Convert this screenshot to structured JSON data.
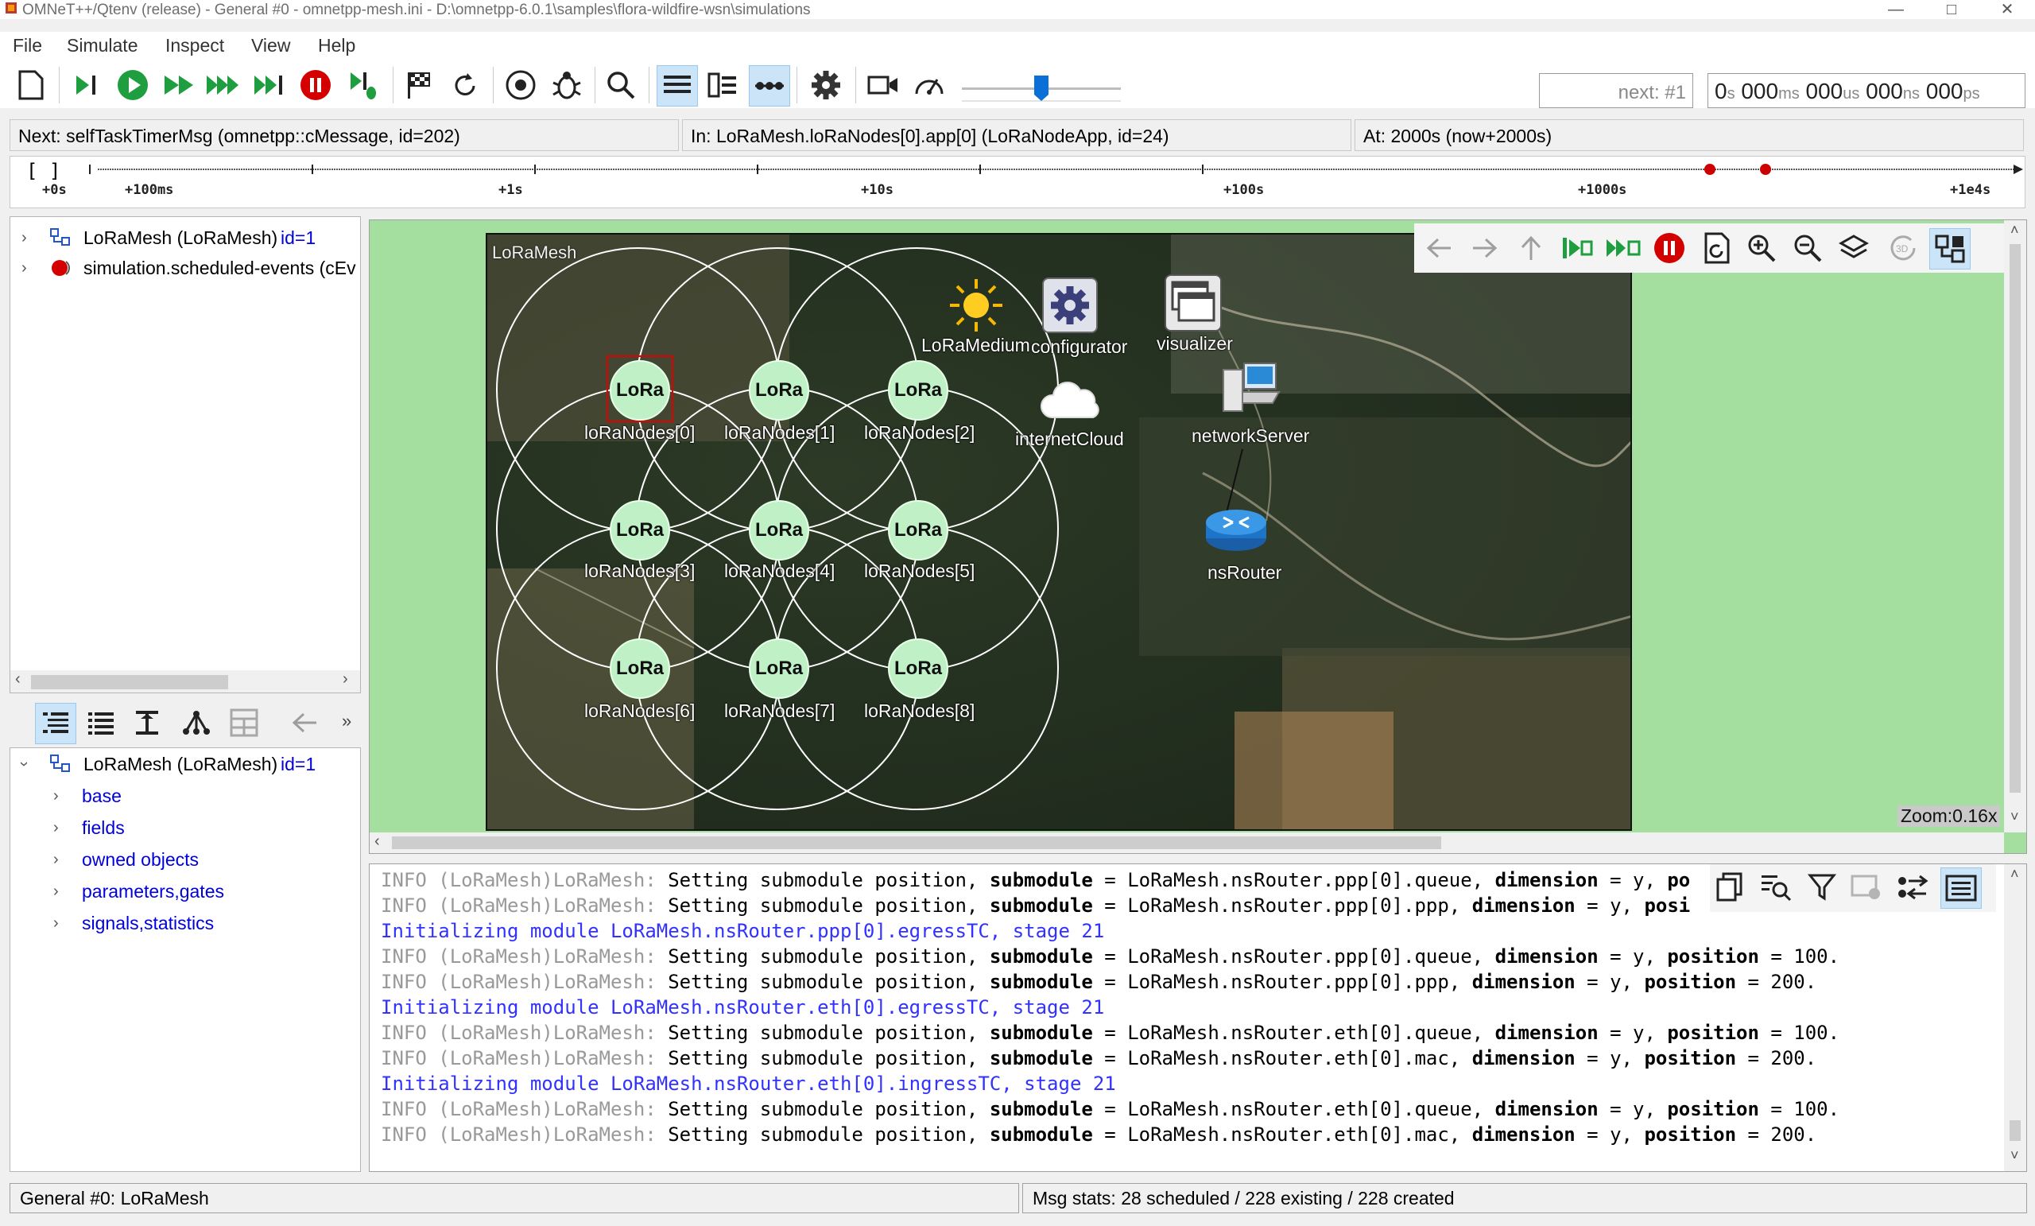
{
  "window": {
    "title": "OMNeT++/Qtenv (release) - General #0 - omnetpp-mesh.ini - D:\\omnetpp-6.0.1\\samples\\flora-wildfire-wsn\\simulations"
  },
  "menu": [
    "File",
    "Simulate",
    "Inspect",
    "View",
    "Help"
  ],
  "toolbar": {
    "next_event": "next: #1",
    "time_display": {
      "s_val": "0",
      "s_unit": "s",
      "ms_val": "000",
      "ms_unit": "ms",
      "us_val": "000",
      "us_unit": "us",
      "ns_val": "000",
      "ns_unit": "ns",
      "ps_val": "000",
      "ps_unit": "ps"
    }
  },
  "status": {
    "next": "Next: selfTaskTimerMsg (omnetpp::cMessage, id=202)",
    "in": "In: LoRaMesh.loRaNodes[0].app[0] (LoRaNodeApp, id=24)",
    "at": "At: 2000s (now+2000s)"
  },
  "timeline": {
    "bracket": "[ ]",
    "labels": [
      "+0s",
      "+100ms",
      "+1s",
      "+10s",
      "+100s",
      "+1000s",
      "+1e4s"
    ]
  },
  "object_tree": {
    "root": {
      "name": "LoRaMesh (LoRaMesh)",
      "id": "id=1"
    },
    "events": "simulation.scheduled-events (cEv"
  },
  "inspector_tree": {
    "root": {
      "name": "LoRaMesh (LoRaMesh)",
      "id": "id=1"
    },
    "children": [
      "base",
      "fields",
      "owned objects",
      "parameters,gates",
      "signals,statistics"
    ]
  },
  "network": {
    "name": "LoRaMesh",
    "zoom": "Zoom:0.16x",
    "nodes": [
      "loRaNodes[0]",
      "loRaNodes[1]",
      "loRaNodes[2]",
      "loRaNodes[3]",
      "loRaNodes[4]",
      "loRaNodes[5]",
      "loRaNodes[6]",
      "loRaNodes[7]",
      "loRaNodes[8]"
    ],
    "node_icon_text": "LoRa",
    "modules": {
      "medium": "LoRaMedium",
      "configurator": "configurator",
      "visualizer": "visualizer",
      "cloud": "internetCloud",
      "server": "networkServer",
      "router": "nsRouter"
    }
  },
  "log": [
    {
      "kind": "info",
      "prefix": "INFO (LoRaMesh)LoRaMesh:",
      "text1": " Setting submodule position, ",
      "k1": "submodule",
      "text2": " = LoRaMesh.nsRouter.ppp[0].queue, ",
      "k2": "dimension",
      "text3": " = y, ",
      "k3": "po",
      "text4": ""
    },
    {
      "kind": "info",
      "prefix": "INFO (LoRaMesh)LoRaMesh:",
      "text1": " Setting submodule position, ",
      "k1": "submodule",
      "text2": " = LoRaMesh.nsRouter.ppp[0].ppp, ",
      "k2": "dimension",
      "text3": " = y, ",
      "k3": "posi",
      "text4": ""
    },
    {
      "kind": "init",
      "text": "Initializing module LoRaMesh.nsRouter.ppp[0].egressTC, stage 21"
    },
    {
      "kind": "info",
      "prefix": "INFO (LoRaMesh)LoRaMesh:",
      "text1": " Setting submodule position, ",
      "k1": "submodule",
      "text2": " = LoRaMesh.nsRouter.ppp[0].queue, ",
      "k2": "dimension",
      "text3": " = y, ",
      "k3": "position",
      "text4": " = 100."
    },
    {
      "kind": "info",
      "prefix": "INFO (LoRaMesh)LoRaMesh:",
      "text1": " Setting submodule position, ",
      "k1": "submodule",
      "text2": " = LoRaMesh.nsRouter.ppp[0].ppp, ",
      "k2": "dimension",
      "text3": " = y, ",
      "k3": "position",
      "text4": " = 200."
    },
    {
      "kind": "init",
      "text": "Initializing module LoRaMesh.nsRouter.eth[0].egressTC, stage 21"
    },
    {
      "kind": "info",
      "prefix": "INFO (LoRaMesh)LoRaMesh:",
      "text1": " Setting submodule position, ",
      "k1": "submodule",
      "text2": " = LoRaMesh.nsRouter.eth[0].queue, ",
      "k2": "dimension",
      "text3": " = y, ",
      "k3": "position",
      "text4": " = 100."
    },
    {
      "kind": "info",
      "prefix": "INFO (LoRaMesh)LoRaMesh:",
      "text1": " Setting submodule position, ",
      "k1": "submodule",
      "text2": " = LoRaMesh.nsRouter.eth[0].mac, ",
      "k2": "dimension",
      "text3": " = y, ",
      "k3": "position",
      "text4": " = 200."
    },
    {
      "kind": "init",
      "text": "Initializing module LoRaMesh.nsRouter.eth[0].ingressTC, stage 21"
    },
    {
      "kind": "info",
      "prefix": "INFO (LoRaMesh)LoRaMesh:",
      "text1": " Setting submodule position, ",
      "k1": "submodule",
      "text2": " = LoRaMesh.nsRouter.eth[0].queue, ",
      "k2": "dimension",
      "text3": " = y, ",
      "k3": "position",
      "text4": " = 100."
    },
    {
      "kind": "info",
      "prefix": "INFO (LoRaMesh)LoRaMesh:",
      "text1": " Setting submodule position, ",
      "k1": "submodule",
      "text2": " = LoRaMesh.nsRouter.eth[0].mac, ",
      "k2": "dimension",
      "text3": " = y, ",
      "k3": "position",
      "text4": " = 200."
    }
  ],
  "bottom_status": {
    "left": "General #0: LoRaMesh",
    "right": "Msg stats: 28 scheduled / 228 existing / 228 created"
  },
  "colors": {
    "canvas_bg": "#a5dfa0",
    "log_init": "#3232ff",
    "run_green": "#1e9e3e",
    "stop_red": "#d40000"
  }
}
